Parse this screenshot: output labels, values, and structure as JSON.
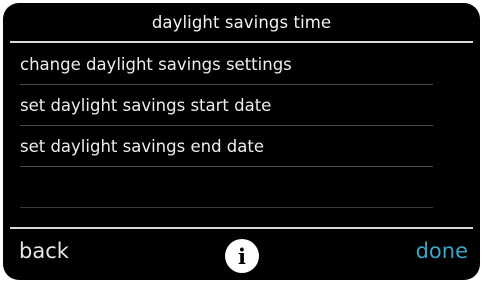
{
  "header": {
    "title": "daylight savings time"
  },
  "menu": {
    "items": [
      {
        "label": "change daylight savings settings"
      },
      {
        "label": "set daylight savings start date"
      },
      {
        "label": "set daylight savings end date"
      }
    ]
  },
  "footer": {
    "back_label": "back",
    "info_icon": "info-icon",
    "info_glyph": "i",
    "done_label": "done"
  },
  "colors": {
    "background": "#000000",
    "text": "#ededed",
    "accent": "#3aa6c4",
    "divider": "#d9d9d9"
  }
}
